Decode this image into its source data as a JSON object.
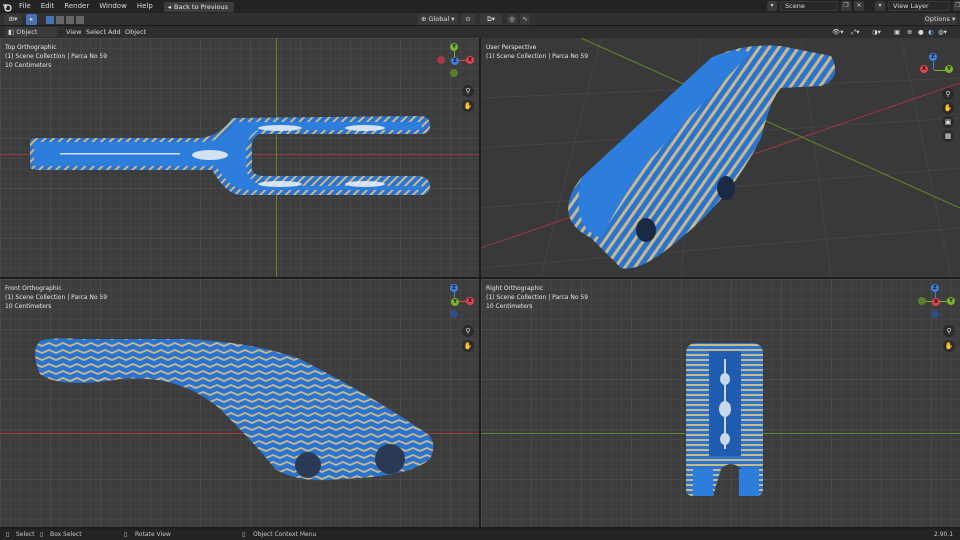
{
  "menubar": {
    "items": [
      "File",
      "Edit",
      "Render",
      "Window",
      "Help"
    ],
    "back_button": "Back to Previous",
    "scene": "Scene",
    "view_layer": "View Layer"
  },
  "toolbar": {
    "transform_orientation": "Global",
    "options": "Options"
  },
  "header": {
    "mode": "Object Mode",
    "menus": [
      "View",
      "Select",
      "Add",
      "Object"
    ]
  },
  "viewports": {
    "top": {
      "view": "Top Orthographic",
      "collection": "(1) Scene Collection | Parca No 59",
      "scale": "10 Centimeters"
    },
    "persp": {
      "view": "User Perspective",
      "collection": "(1) Scene Collection | Parca No 59",
      "scale": ""
    },
    "front": {
      "view": "Front Orthographic",
      "collection": "(1) Scene Collection | Parca No 59",
      "scale": "10 Centimeters"
    },
    "right": {
      "view": "Right Orthographic",
      "collection": "(1) Scene Collection | Parca No 59",
      "scale": "10 Centimeters"
    }
  },
  "gizmo_labels": {
    "x": "X",
    "y": "Y",
    "z": "Z"
  },
  "statusbar": {
    "select": "Select",
    "box_select": "Box Select",
    "rotate_view": "Rotate View",
    "context_menu": "Object Context Menu",
    "version": "2.90.1"
  },
  "colors": {
    "accent": "#4772b3",
    "x_axis": "#e0434f",
    "y_axis": "#7ab22d",
    "z_axis": "#3f80e0",
    "part_blue": "#2a74d0",
    "part_stripe": "#c9b98a"
  },
  "icons": [
    "blender-logo-icon",
    "cursor-icon",
    "select-box-icon",
    "global-orientation-icon",
    "snap-icon",
    "proportional-edit-icon",
    "zoom-icon",
    "pan-hand-icon",
    "camera-icon",
    "grid-icon",
    "overlay-icon",
    "shading-solid-icon",
    "shading-material-icon",
    "shading-rendered-icon",
    "mouse-left-icon",
    "mouse-middle-icon",
    "mouse-right-icon"
  ]
}
